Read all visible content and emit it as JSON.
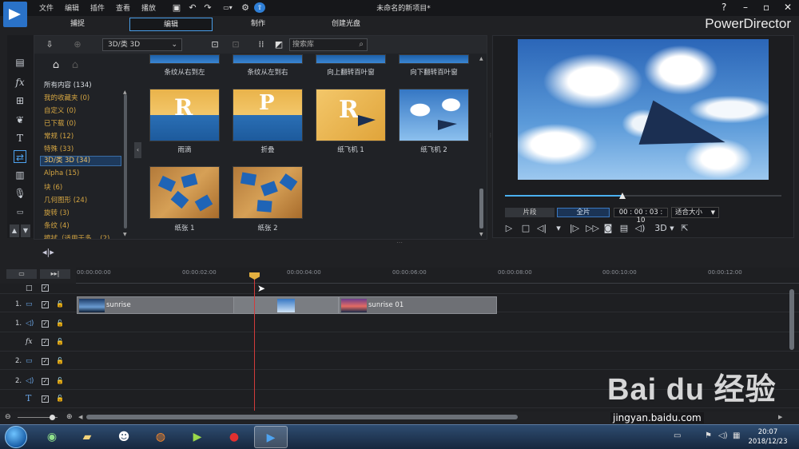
{
  "titlebar": {
    "menus": [
      "文件",
      "编辑",
      "插件",
      "查看",
      "播放"
    ],
    "doc_title": "未命名的新项目*",
    "win_controls": [
      "?",
      "–",
      "▫",
      "✕"
    ]
  },
  "mode_tabs": [
    "捕捉",
    "编辑",
    "制作",
    "创建光盘"
  ],
  "brand": "PowerDirector",
  "library": {
    "category_select": "3D/类 3D",
    "search_placeholder": "搜索库",
    "categories": [
      "所有内容 (134)",
      "我的收藏夹 (0)",
      "自定义 (0)",
      "已下载 (0)",
      "常规 (12)",
      "特殊 (33)",
      "3D/类 3D (34)",
      "Alpha (15)",
      "块 (6)",
      "几何图形 (24)",
      "旋转 (3)",
      "条纹 (4)",
      "擦拭（适用于多... (2)"
    ],
    "selected_category_index": 6,
    "top_row_labels": [
      "条纹从右到左",
      "条纹从左到右",
      "向上翻转百叶窗",
      "向下翻转百叶窗"
    ],
    "thumbnails": [
      {
        "label": "雨滴",
        "style": "gold"
      },
      {
        "label": "折叠",
        "style": "gold"
      },
      {
        "label": "纸飞机 1",
        "style": "gold"
      },
      {
        "label": "纸飞机 2",
        "style": "sky"
      },
      {
        "label": "纸张 1",
        "style": "wood"
      },
      {
        "label": "纸张 2",
        "style": "wood"
      }
    ]
  },
  "preview": {
    "btn_clip": "片段",
    "btn_full": "全片",
    "timecode": "00 : 00 : 03 : 10",
    "fit": "适合大小",
    "progress": 0.42,
    "mode_3d": "3D"
  },
  "timeline": {
    "ruler_labels": [
      "00:00:00:00",
      "00:00:02:00",
      "00:00:04:00",
      "00:00:06:00",
      "00:00:08:00",
      "00:00:10:00",
      "00:00:12:00"
    ],
    "tracks": [
      {
        "num": "",
        "kind": "master"
      },
      {
        "num": "1.",
        "kind": "video"
      },
      {
        "num": "1.",
        "kind": "audio"
      },
      {
        "num": "",
        "kind": "fx"
      },
      {
        "num": "2.",
        "kind": "video"
      },
      {
        "num": "2.",
        "kind": "audio"
      },
      {
        "num": "",
        "kind": "title"
      },
      {
        "num": "",
        "kind": "voice"
      }
    ],
    "clips": [
      {
        "label": "sunrise"
      },
      {
        "label": "sunrise 01"
      }
    ]
  },
  "taskbar": {
    "time": "20:07",
    "date": "2018/12/23"
  },
  "watermark": {
    "text": "Bai du 经验",
    "url": "jingyan.baidu.com"
  }
}
